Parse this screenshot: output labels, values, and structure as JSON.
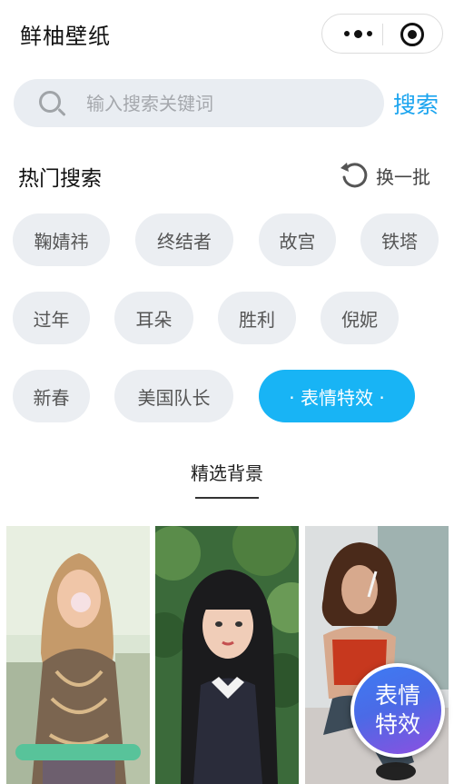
{
  "header": {
    "title": "鲜柚壁纸"
  },
  "search": {
    "placeholder": "输入搜索关键词",
    "button_label": "搜索"
  },
  "hot": {
    "title": "热门搜索",
    "refresh_label": "换一批",
    "tags": [
      {
        "label": "鞠婧祎",
        "active": false
      },
      {
        "label": "终结者",
        "active": false
      },
      {
        "label": "故宫",
        "active": false
      },
      {
        "label": "铁塔",
        "active": false
      },
      {
        "label": "过年",
        "active": false
      },
      {
        "label": "耳朵",
        "active": false
      },
      {
        "label": "胜利",
        "active": false
      },
      {
        "label": "倪妮",
        "active": false
      },
      {
        "label": "新春",
        "active": false
      },
      {
        "label": "美国队长",
        "active": false
      },
      {
        "label": "· 表情特效 ·",
        "active": true
      }
    ]
  },
  "featured": {
    "title": "精选背景"
  },
  "badge": {
    "line1": "表情",
    "line2": "特效"
  },
  "colors": {
    "accent": "#18b4f5",
    "tag_bg": "#ebeef2",
    "search_bg": "#e9edf2"
  }
}
